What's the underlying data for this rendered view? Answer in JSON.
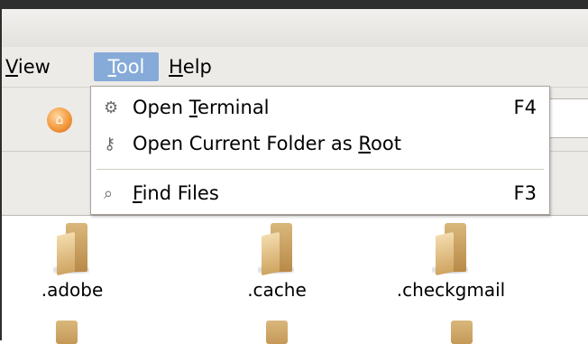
{
  "menubar": {
    "items": [
      {
        "prefix": "",
        "mnemonic": "V",
        "rest": "iew"
      },
      {
        "prefix": "",
        "mnemonic": "T",
        "rest": "ool"
      },
      {
        "prefix": "",
        "mnemonic": "H",
        "rest": "elp"
      }
    ]
  },
  "tool_menu": {
    "items": [
      {
        "prefix": "Open ",
        "mnemonic": "T",
        "rest": "erminal",
        "accel": "F4",
        "icon": "terminal-gears-icon"
      },
      {
        "prefix": "Open Current Folder as ",
        "mnemonic": "R",
        "rest": "oot",
        "accel": "",
        "icon": "key-icon"
      },
      {
        "prefix": "",
        "mnemonic": "F",
        "rest": "ind Files",
        "accel": "F3",
        "icon": "find-files-icon"
      }
    ]
  },
  "files": [
    {
      "name": ".adobe",
      "icon": "folder-icon"
    },
    {
      "name": ".cache",
      "icon": "folder-icon"
    },
    {
      "name": ".checkgmail",
      "icon": "folder-icon"
    }
  ],
  "colors": {
    "menu_highlight": "#86abd9",
    "frame": "#2e2e2e",
    "chrome": "#edebe8"
  }
}
